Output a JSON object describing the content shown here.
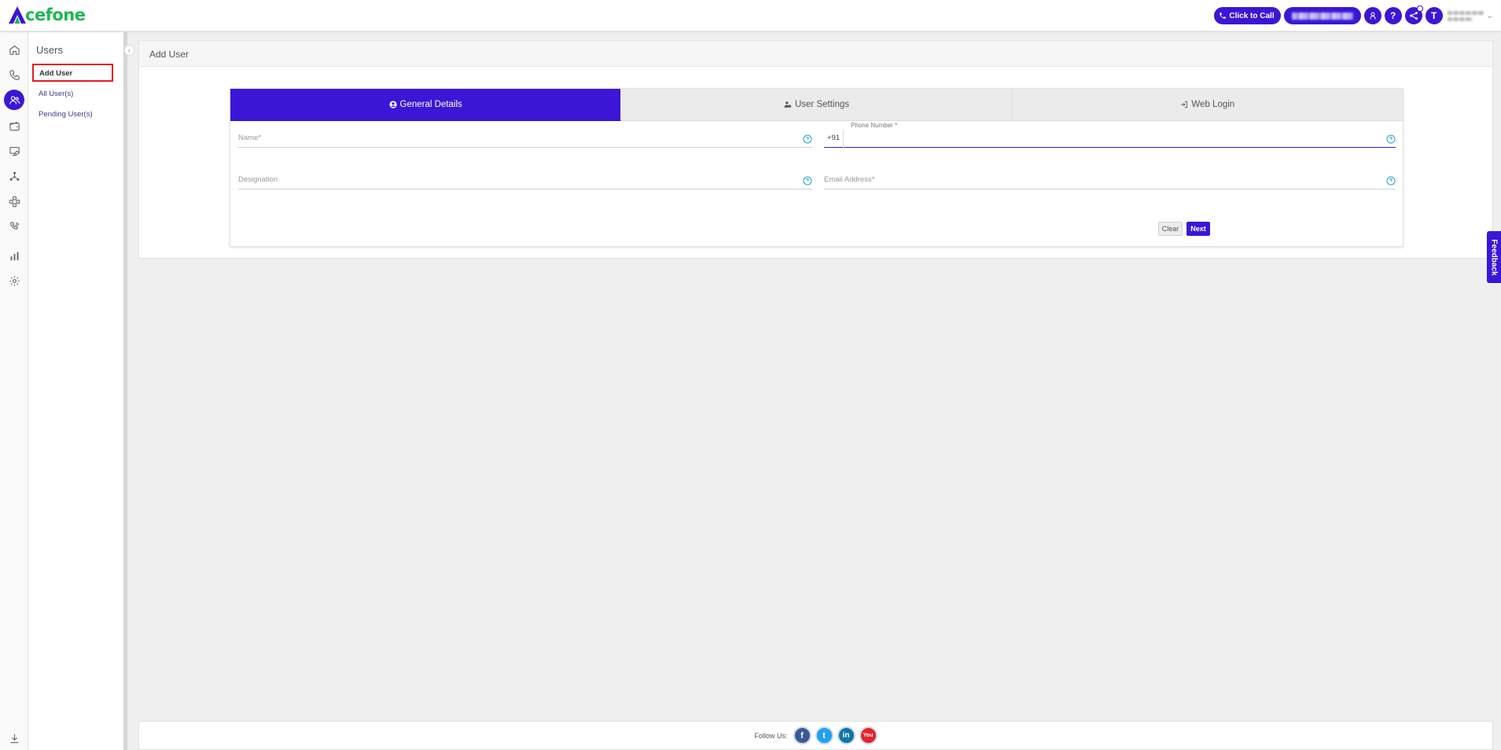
{
  "brand": {
    "logo_text": "cefone",
    "accent": "#3b16d6",
    "logo_green": "#1fb655"
  },
  "topbar": {
    "click_to_call_label": "Click to Call",
    "avatar_initial": "T",
    "help_label": "?"
  },
  "rail": {
    "items": [
      {
        "icon": "home-icon"
      },
      {
        "icon": "phone-icon"
      },
      {
        "icon": "users-icon",
        "active": true
      },
      {
        "icon": "wallet-icon"
      },
      {
        "icon": "monitor-icon"
      },
      {
        "icon": "network-icon"
      },
      {
        "icon": "integration-icon"
      },
      {
        "icon": "ivr-icon"
      },
      {
        "icon": "bar-chart-icon"
      },
      {
        "icon": "settings-icon"
      },
      {
        "icon": "download-icon"
      }
    ]
  },
  "subnav": {
    "title": "Users",
    "items": [
      {
        "label": "Add User",
        "active": true
      },
      {
        "label": "All User(s)"
      },
      {
        "label": "Pending User(s)"
      }
    ]
  },
  "main": {
    "page_title": "Add User",
    "tabs": [
      {
        "label": "General Details",
        "icon": "user-circle-icon",
        "active": true
      },
      {
        "label": "User Settings",
        "icon": "users-cog-icon"
      },
      {
        "label": "Web Login",
        "icon": "sign-in-icon"
      }
    ],
    "form": {
      "name_placeholder": "Name*",
      "phone_label": "Phone Number *",
      "phone_prefix": "+91",
      "designation_placeholder": "Designation",
      "email_placeholder": "Email Address*",
      "clear_label": "Clear",
      "next_label": "Next"
    }
  },
  "footer": {
    "follow_label": "Follow Us:",
    "social": [
      {
        "name": "facebook",
        "glyph": "f"
      },
      {
        "name": "twitter",
        "glyph": "t"
      },
      {
        "name": "linkedin",
        "glyph": "in"
      },
      {
        "name": "youtube",
        "glyph": "You"
      }
    ]
  },
  "feedback_label": "Feedback"
}
